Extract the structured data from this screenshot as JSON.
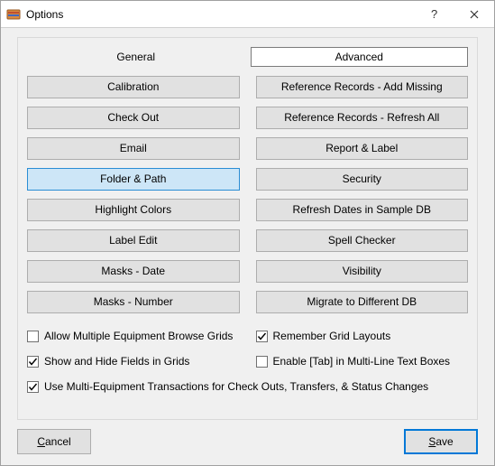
{
  "window": {
    "title": "Options"
  },
  "tabs": {
    "general": "General",
    "advanced": "Advanced"
  },
  "left_buttons": [
    "Calibration",
    "Check Out",
    "Email",
    "Folder & Path",
    "Highlight Colors",
    "Label Edit",
    "Masks - Date",
    "Masks - Number"
  ],
  "right_buttons": [
    "Reference Records - Add Missing",
    "Reference Records - Refresh All",
    "Report & Label",
    "Security",
    "Refresh Dates in Sample DB",
    "Spell Checker",
    "Visibility",
    "Migrate to Different DB"
  ],
  "checkboxes": {
    "allow_multiple": {
      "label": "Allow Multiple Equipment Browse Grids",
      "checked": false
    },
    "remember_grid": {
      "label": "Remember Grid Layouts",
      "checked": true
    },
    "show_hide": {
      "label": "Show and Hide Fields in Grids",
      "checked": true
    },
    "enable_tab": {
      "label": "Enable [Tab] in Multi-Line Text Boxes",
      "checked": false
    },
    "use_multi": {
      "label": "Use Multi-Equipment Transactions for Check Outs, Transfers, & Status Changes",
      "checked": true
    }
  },
  "footer": {
    "cancel": "Cancel",
    "save": "Save"
  },
  "selected_left_index": 3
}
